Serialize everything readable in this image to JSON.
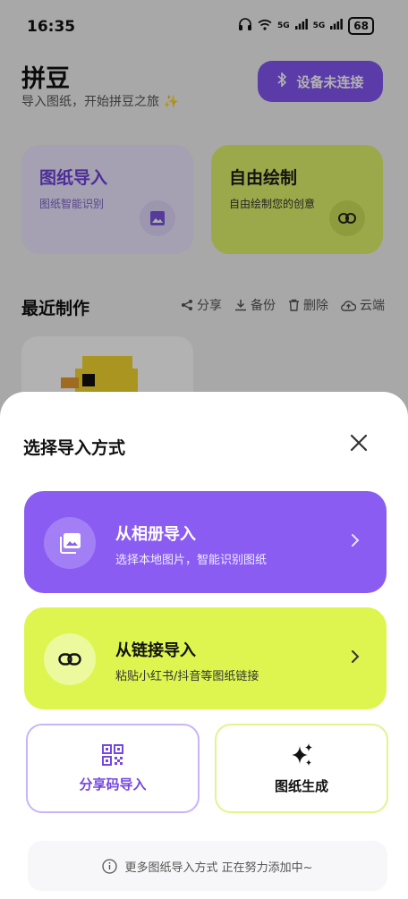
{
  "status_bar": {
    "time": "16:35",
    "signal_1": "5G",
    "signal_2": "5G",
    "battery": "68"
  },
  "header": {
    "title": "拼豆",
    "subtitle": "导入图纸，开始拼豆之旅 ✨",
    "device_button": "设备未连接"
  },
  "cards": {
    "import": {
      "title": "图纸导入",
      "subtitle": "图纸智能识别",
      "icon": "image-icon"
    },
    "draw": {
      "title": "自由绘制",
      "subtitle": "自由绘制您的创意",
      "icon": "link-icon"
    }
  },
  "recent": {
    "title": "最近制作",
    "actions": [
      "分享",
      "备份",
      "删除",
      "云端"
    ]
  },
  "sheet": {
    "title": "选择导入方式",
    "options": [
      {
        "title": "从相册导入",
        "subtitle": "选择本地图片，智能识别图纸",
        "icon": "gallery-icon",
        "color": "#8a5cf2"
      },
      {
        "title": "从链接导入",
        "subtitle": "粘贴小红书/抖音等图纸链接",
        "icon": "link-icon",
        "color": "#ddf54e"
      }
    ],
    "tiles": [
      {
        "label": "分享码导入",
        "icon": "qr-code-icon"
      },
      {
        "label": "图纸生成",
        "icon": "sparkle-icon"
      }
    ],
    "footer_note": "更多图纸导入方式 正在努力添加中~"
  },
  "colors": {
    "accent_purple": "#8355f0",
    "accent_lime": "#ddf54e"
  }
}
